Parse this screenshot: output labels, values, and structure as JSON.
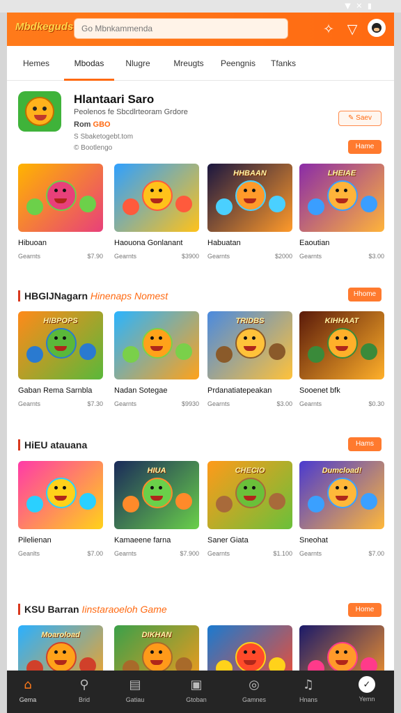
{
  "status_bar": {
    "icons": "wifi-icon signal-icon battery-icon",
    "glyphs": "▼ ✕ ▮"
  },
  "header": {
    "logo": "Mbdkeguds",
    "search_placeholder": "Go Mbnkammenda",
    "icons": [
      "ticket-icon",
      "filter-icon",
      "avatar"
    ]
  },
  "tabs": [
    {
      "label": "Hemes"
    },
    {
      "label": "Mbodas",
      "active": true
    },
    {
      "label": "Nlugre"
    },
    {
      "label": "Mreugts"
    },
    {
      "label": "Peengnis"
    },
    {
      "label": "Tfanks"
    }
  ],
  "featured": {
    "title": "Hlantaari Saro",
    "subtitle": "Peolenos fe Sbcdlrteoram Grdore",
    "meta_label": "Rom",
    "meta_value": "GBO",
    "site": "S Sbaketogebt.tom",
    "developer": "© Bootlengo",
    "action_label": "✎ Saev"
  },
  "sections": [
    {
      "title": "",
      "title_accent": "",
      "more_label": "Hame",
      "cards": [
        {
          "name": "Hibuoan",
          "category": "Gearnts",
          "price": "$7.90",
          "colors": [
            "#ffb400",
            "#e8407a",
            "#6cd04a"
          ]
        },
        {
          "name": "Haouona Gonlanant",
          "category": "Gearnts",
          "price": "$3900",
          "colors": [
            "#2fa0ff",
            "#ffc21a",
            "#ff5a3c"
          ]
        },
        {
          "name": "Habuatan",
          "category": "Gearnts",
          "price": "$2000",
          "colors": [
            "#1a1640",
            "#ff9a2a",
            "#4ad0ff"
          ],
          "banner": "HHBAAN"
        },
        {
          "name": "Eaoutian",
          "category": "Gearnts",
          "price": "$3.00",
          "colors": [
            "#8a2ba8",
            "#ffb43a",
            "#3a9eff"
          ],
          "banner": "LHEIAE"
        }
      ]
    },
    {
      "title": "HBGlJNagarn",
      "title_accent": "Hinenaps Nomest",
      "more_label": "Hhome",
      "cards": [
        {
          "name": "Gaban Rema Sarnbla",
          "category": "Gearnts",
          "price": "$7.30",
          "colors": [
            "#ff8a1a",
            "#5ab83a",
            "#2a7ad0"
          ],
          "banner": "HIBPOPS"
        },
        {
          "name": "Nadan Sotegae",
          "category": "Gearnts",
          "price": "$9930",
          "colors": [
            "#2ab4ff",
            "#ffa21a",
            "#7ad04a"
          ]
        },
        {
          "name": "Prdanatiatepeakan",
          "category": "Gearnts",
          "price": "$3.00",
          "colors": [
            "#4a8adf",
            "#ffc23a",
            "#8a5a2a"
          ],
          "banner": "TRIDBS"
        },
        {
          "name": "Sooenet bfk",
          "category": "Gearnts",
          "price": "$0.30",
          "colors": [
            "#5a1a0a",
            "#ffb02a",
            "#3a8a3a"
          ],
          "banner": "KIHHAAT"
        }
      ]
    },
    {
      "title": "HiEU atauana",
      "title_accent": "",
      "more_label": "Hams",
      "cards": [
        {
          "name": "Pilelienan",
          "category": "Geanlts",
          "price": "$7.00",
          "colors": [
            "#ff3aa8",
            "#ffd21a",
            "#2ad0ff"
          ]
        },
        {
          "name": "Kamaeene farna",
          "category": "Gearnts",
          "price": "$7.900",
          "colors": [
            "#1a2a5a",
            "#6ad04a",
            "#ff8a2a"
          ],
          "banner": "HIUA"
        },
        {
          "name": "Saner Giata",
          "category": "Gearnts",
          "price": "$1.100",
          "colors": [
            "#ff9a1a",
            "#6ac03a",
            "#a86a3a"
          ],
          "banner": "CHECIO"
        },
        {
          "name": "Sneohat",
          "category": "Gearnts",
          "price": "$7.00",
          "colors": [
            "#4a3ad0",
            "#ffb83a",
            "#3aa0ff"
          ],
          "banner": "Dumcload!"
        }
      ]
    },
    {
      "title": "KSU Barran",
      "title_accent": "Iinstaraoeloh Game",
      "more_label": "Home",
      "cards": [
        {
          "name": "",
          "category": "",
          "price": "",
          "colors": [
            "#2ab0ff",
            "#ffa21a",
            "#d0402a"
          ],
          "banner": "Moaroload"
        },
        {
          "name": "",
          "category": "",
          "price": "",
          "colors": [
            "#3aa04a",
            "#ff9a1a",
            "#a86a2a"
          ],
          "banner": "DIKHAN"
        },
        {
          "name": "",
          "category": "",
          "price": "",
          "colors": [
            "#1a7ad0",
            "#ff4a2a",
            "#ffd21a"
          ]
        },
        {
          "name": "",
          "category": "",
          "price": "",
          "colors": [
            "#1a1a6a",
            "#ff9a2a",
            "#ff3a8a"
          ]
        }
      ]
    }
  ],
  "bottom_nav": [
    {
      "label": "Gema",
      "icon": "home-icon",
      "glyph": "⌂",
      "active": true
    },
    {
      "label": "Brid",
      "icon": "search-icon",
      "glyph": "⚲"
    },
    {
      "label": "Gatiau",
      "icon": "library-icon",
      "glyph": "▤"
    },
    {
      "label": "Gtoban",
      "icon": "gamepad-icon",
      "glyph": "▣"
    },
    {
      "label": "Gamnes",
      "icon": "controller-icon",
      "glyph": "◎"
    },
    {
      "label": "Hnans",
      "icon": "music-icon",
      "glyph": "♫"
    },
    {
      "label": "Yemn",
      "icon": "profile-icon",
      "glyph": "✓"
    }
  ],
  "colors": {
    "accent": "#ff6a12",
    "nav_bg": "#252525"
  }
}
